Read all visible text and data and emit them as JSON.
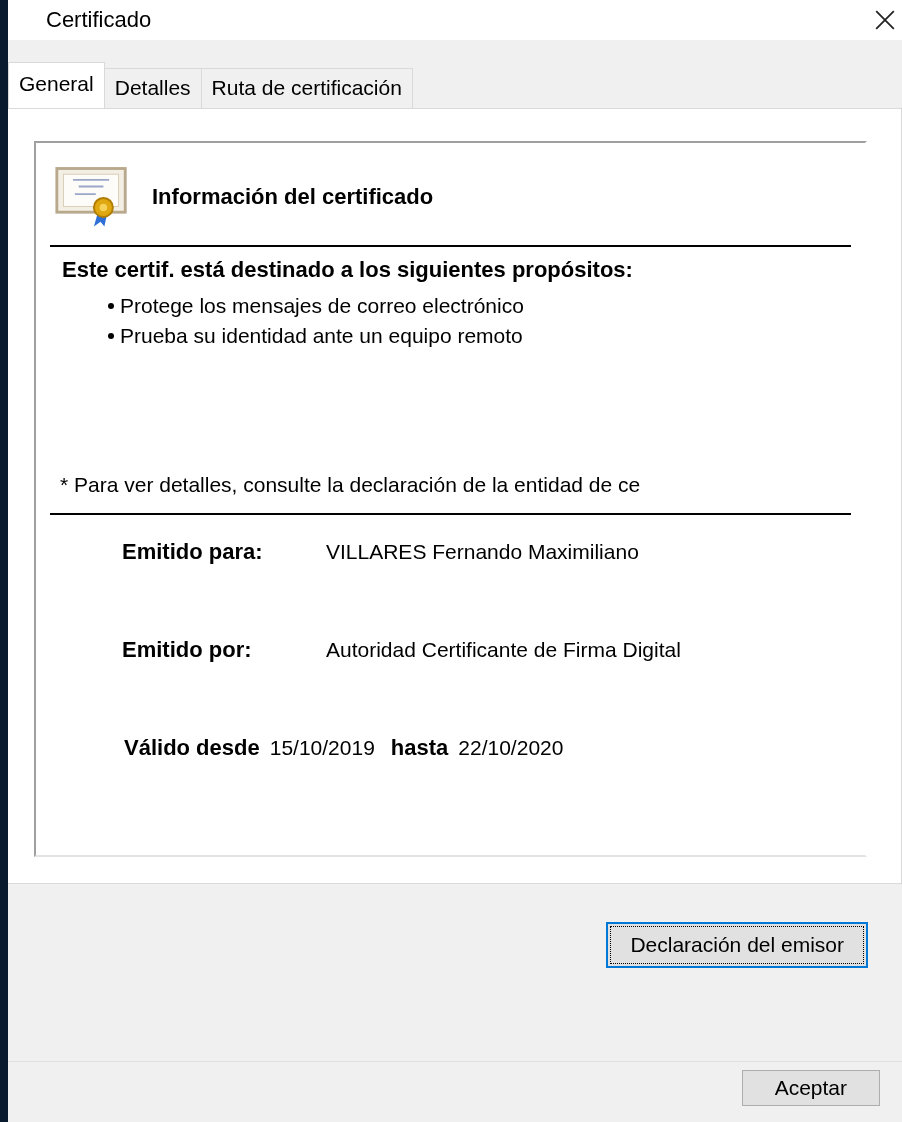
{
  "window": {
    "title": "Certificado"
  },
  "tabs": [
    {
      "label": "General",
      "selected": true
    },
    {
      "label": "Detalles",
      "selected": false
    },
    {
      "label": "Ruta de certificación",
      "selected": false
    }
  ],
  "certificate": {
    "heading": "Información del certificado",
    "purposes_heading": "Este certif. está destinado a los siguientes propósitos:",
    "purposes": [
      "Protege los mensajes de correo electrónico",
      "Prueba su identidad ante un equipo remoto"
    ],
    "note": "* Para ver detalles, consulte la declaración de la entidad de ce",
    "fields": [
      {
        "label": "Emitido para:",
        "value": "VILLARES Fernando Maximiliano"
      },
      {
        "label": "Emitido por:",
        "value": "Autoridad Certificante de Firma Digital"
      }
    ],
    "validity": {
      "from_label": "Válido desde",
      "from": "15/10/2019",
      "to_label": "hasta",
      "to": "22/10/2020"
    }
  },
  "issuer_button": {
    "label": "Declaración del emisor",
    "focused": true
  },
  "ok_button": {
    "label": "Aceptar"
  }
}
